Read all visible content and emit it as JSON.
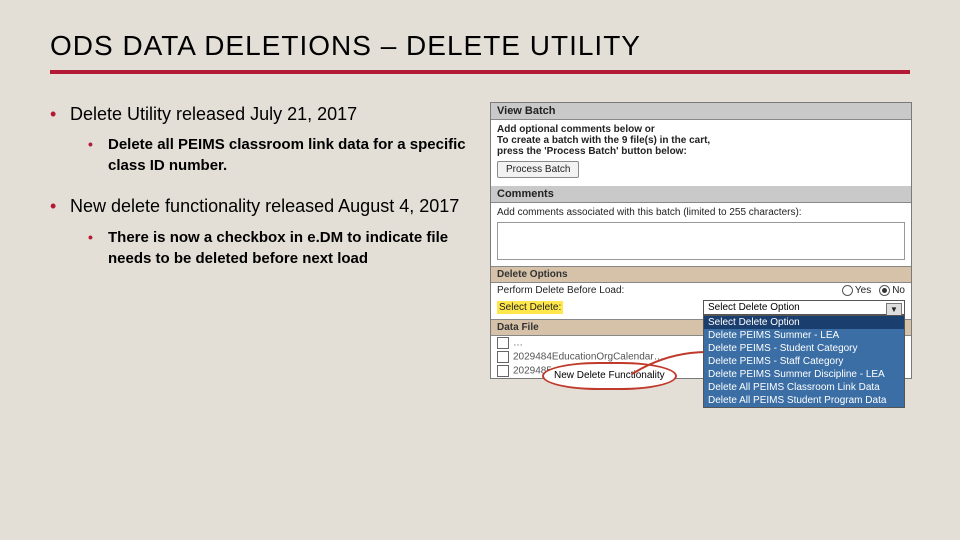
{
  "slide": {
    "title": "ODS DATA DELETIONS – DELETE UTILITY",
    "bullets": [
      {
        "text": "Delete Utility released July 21, 2017",
        "sub": [
          "Delete all PEIMS classroom link data for a specific class ID number."
        ]
      },
      {
        "text": "New delete functionality released August 4, 2017",
        "sub": [
          "There is now a checkbox in e.DM to indicate file needs to be deleted before next load"
        ]
      }
    ]
  },
  "panel": {
    "view_batch": "View Batch",
    "intro_line1": "Add optional comments below or",
    "intro_line2": "To create a batch with the 9 file(s) in the cart,",
    "intro_line3": "press the 'Process Batch' button below:",
    "process_btn": "Process Batch",
    "comments_hdr": "Comments",
    "comments_hint": "Add comments associated with this batch (limited to 255 characters):",
    "delete_opts_hdr": "Delete Options",
    "perform_label": "Perform Delete Before Load:",
    "yes": "Yes",
    "no": "No",
    "select_delete_label": "Select Delete:",
    "dd_options": [
      "Select Delete Option",
      "Select Delete Option",
      "Delete PEIMS Summer - LEA",
      "Delete PEIMS - Student Category",
      "Delete PEIMS - Staff Category",
      "Delete PEIMS Summer Discipline - LEA",
      "Delete All PEIMS Classroom Link Data",
      "Delete All PEIMS Student Program Data"
    ],
    "data_file_hdr": "Data File",
    "files": [
      "2029484EducationOrgCalendar…",
      "2029485…"
    ],
    "callout": "New Delete Functionality"
  }
}
